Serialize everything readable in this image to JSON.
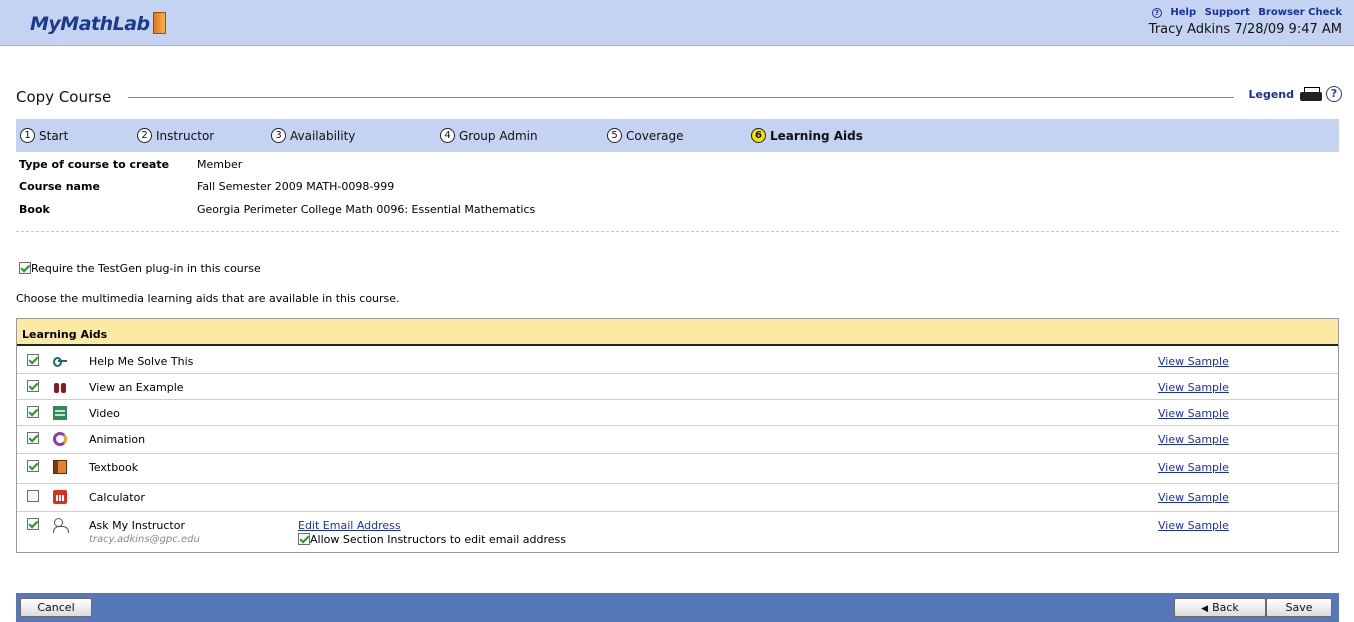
{
  "header": {
    "logo": "MyMathLab",
    "help_label": "Help",
    "support_label": "Support",
    "browser_check_label": "Browser Check",
    "user_line": "Tracy Adkins 7/28/09 9:47 AM"
  },
  "page": {
    "title": "Copy Course",
    "legend_label": "Legend"
  },
  "steps": [
    {
      "num": "1",
      "label": "Start"
    },
    {
      "num": "2",
      "label": "Instructor"
    },
    {
      "num": "3",
      "label": "Availability"
    },
    {
      "num": "4",
      "label": "Group Admin"
    },
    {
      "num": "5",
      "label": "Coverage"
    },
    {
      "num": "6",
      "label": "Learning Aids"
    }
  ],
  "active_step": "6",
  "course_info": {
    "type_label": "Type of course to create",
    "type_value": "Member",
    "name_label": "Course name",
    "name_value": "Fall Semester 2009 MATH-0098-999",
    "book_label": "Book",
    "book_value": "Georgia Perimeter College Math 0096: Essential Mathematics"
  },
  "options": {
    "testgen_label": "Require the TestGen plug-in in this course",
    "testgen_checked": true,
    "choose_text": "Choose the multimedia learning aids that are available in this course."
  },
  "aids_table": {
    "header": "Learning Aids",
    "view_sample_label": "View Sample",
    "rows": [
      {
        "label": "Help Me Solve This",
        "icon": "key-icon",
        "checked": true
      },
      {
        "label": "View an Example",
        "icon": "binoculars-icon",
        "checked": true
      },
      {
        "label": "Video",
        "icon": "film-icon",
        "checked": true
      },
      {
        "label": "Animation",
        "icon": "animation-icon",
        "checked": true
      },
      {
        "label": "Textbook",
        "icon": "book-icon",
        "checked": true
      },
      {
        "label": "Calculator",
        "icon": "calculator-icon",
        "checked": false
      },
      {
        "label": "Ask My Instructor",
        "icon": "person-icon",
        "checked": true
      }
    ],
    "instructor_email": "tracy.adkins@gpc.edu",
    "edit_email_label": "Edit Email Address",
    "allow_edit_label": "Allow Section Instructors to edit email address",
    "allow_edit_checked": true
  },
  "footer": {
    "cancel_label": "Cancel",
    "back_label": "Back",
    "save_label": "Save"
  }
}
